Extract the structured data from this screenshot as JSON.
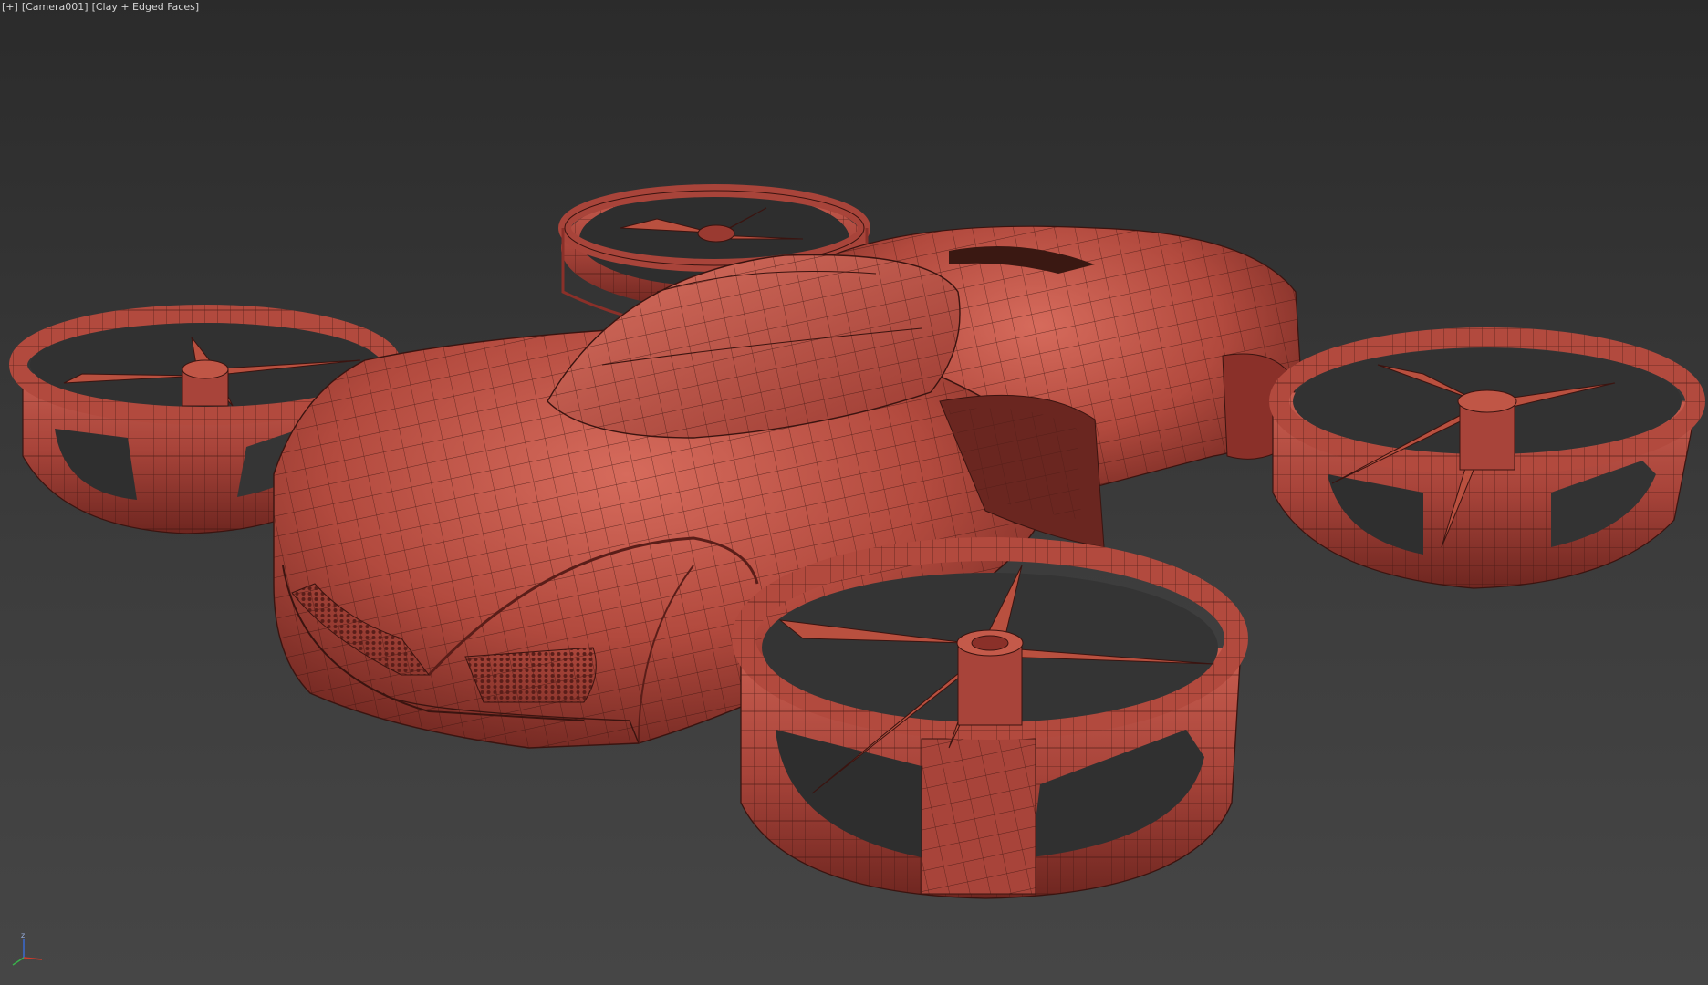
{
  "viewport": {
    "plus_menu": "[+]",
    "camera_menu": "[Camera001]",
    "shading_menu": "[Clay + Edged Faces]"
  },
  "colors": {
    "background_top": "#2b2b2b",
    "background_bottom": "#464646",
    "clay": "#b24a3e",
    "clay_light": "#cc6355",
    "clay_dark": "#6e2620",
    "wire": "#3a1410"
  },
  "gizmo": {
    "z_label": "z",
    "x_color": "#d23a2a",
    "y_color": "#3ab24a",
    "z_color": "#3a6ad2"
  },
  "icons": [
    "axis-tripod-icon"
  ]
}
